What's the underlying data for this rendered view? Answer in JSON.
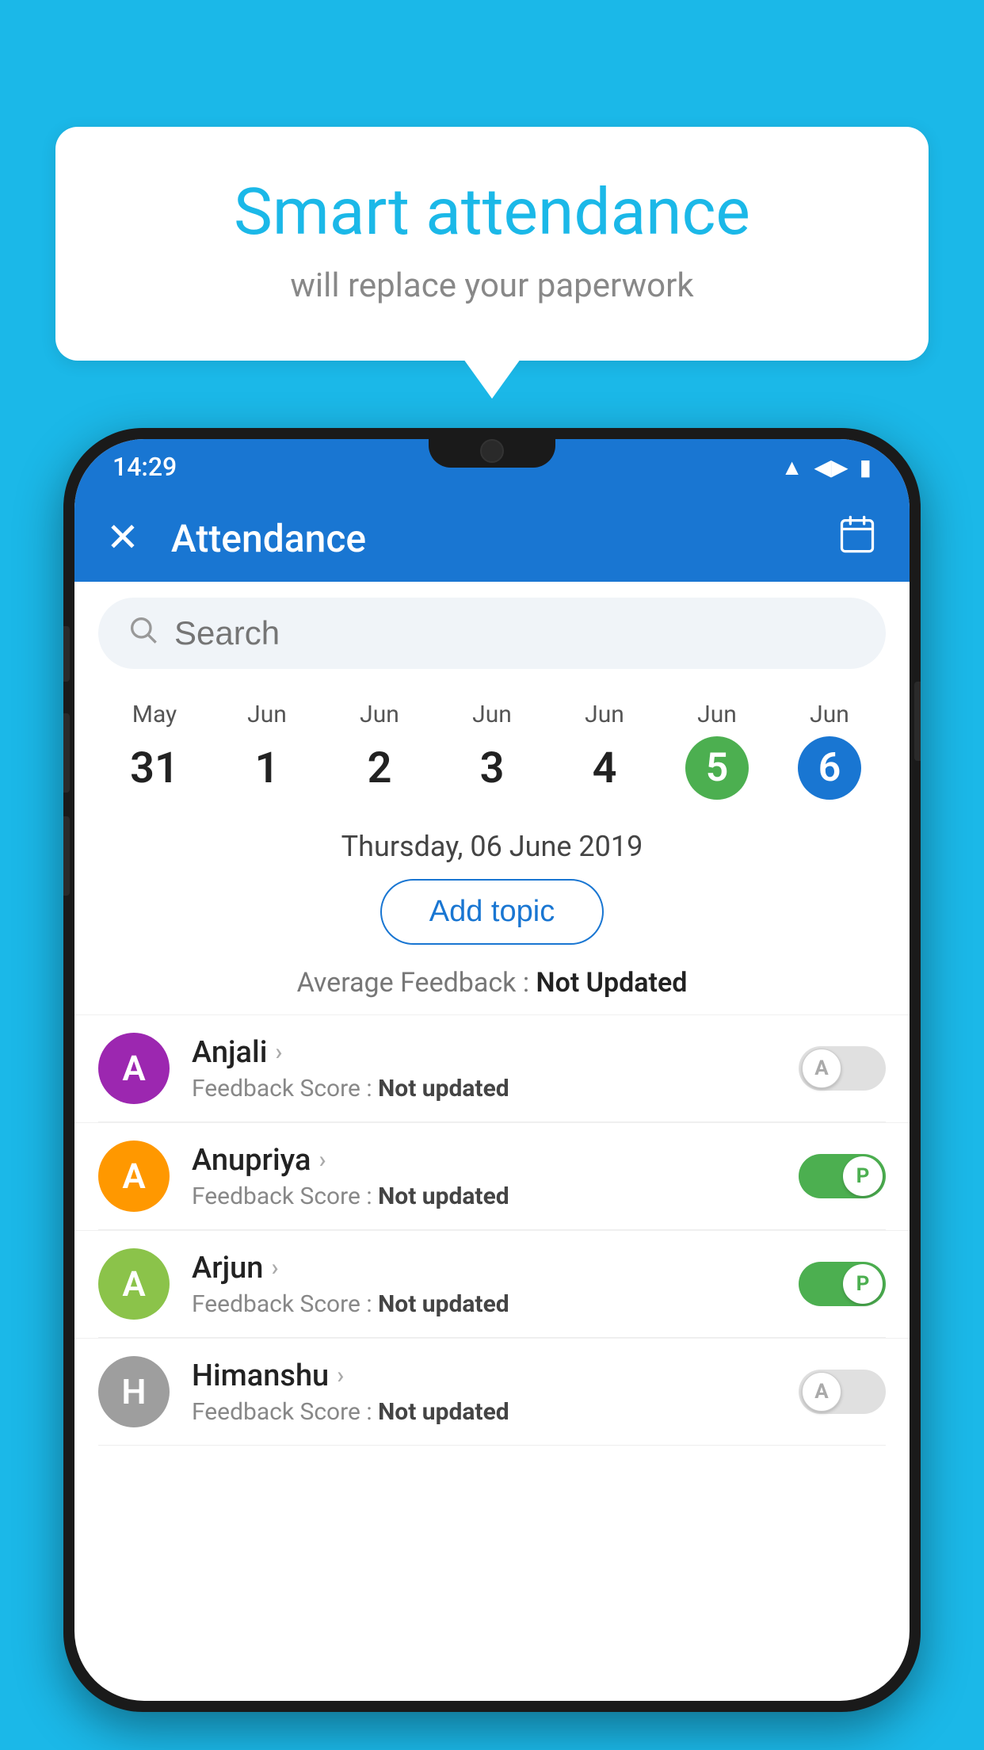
{
  "background_color": "#1bb8e8",
  "speech_bubble": {
    "title": "Smart attendance",
    "subtitle": "will replace your paperwork"
  },
  "status_bar": {
    "time": "14:29",
    "icons": [
      "wifi",
      "signal",
      "battery"
    ]
  },
  "app_bar": {
    "title": "Attendance",
    "close_label": "×",
    "calendar_label": "📅"
  },
  "search": {
    "placeholder": "Search"
  },
  "calendar": {
    "days": [
      {
        "month": "May",
        "date": "31",
        "state": "normal"
      },
      {
        "month": "Jun",
        "date": "1",
        "state": "normal"
      },
      {
        "month": "Jun",
        "date": "2",
        "state": "normal"
      },
      {
        "month": "Jun",
        "date": "3",
        "state": "normal"
      },
      {
        "month": "Jun",
        "date": "4",
        "state": "normal"
      },
      {
        "month": "Jun",
        "date": "5",
        "state": "today"
      },
      {
        "month": "Jun",
        "date": "6",
        "state": "selected"
      }
    ],
    "selected_date_label": "Thursday, 06 June 2019"
  },
  "add_topic_button": "Add topic",
  "average_feedback": {
    "label": "Average Feedback : ",
    "value": "Not Updated"
  },
  "students": [
    {
      "name": "Anjali",
      "avatar_letter": "A",
      "avatar_color": "#9c27b0",
      "feedback": "Not updated",
      "toggle_state": "off",
      "toggle_label": "A"
    },
    {
      "name": "Anupriya",
      "avatar_letter": "A",
      "avatar_color": "#ff9800",
      "feedback": "Not updated",
      "toggle_state": "on",
      "toggle_label": "P"
    },
    {
      "name": "Arjun",
      "avatar_letter": "A",
      "avatar_color": "#8bc34a",
      "feedback": "Not updated",
      "toggle_state": "on",
      "toggle_label": "P"
    },
    {
      "name": "Himanshu",
      "avatar_letter": "H",
      "avatar_color": "#9e9e9e",
      "feedback": "Not updated",
      "toggle_state": "off",
      "toggle_label": "A"
    }
  ]
}
